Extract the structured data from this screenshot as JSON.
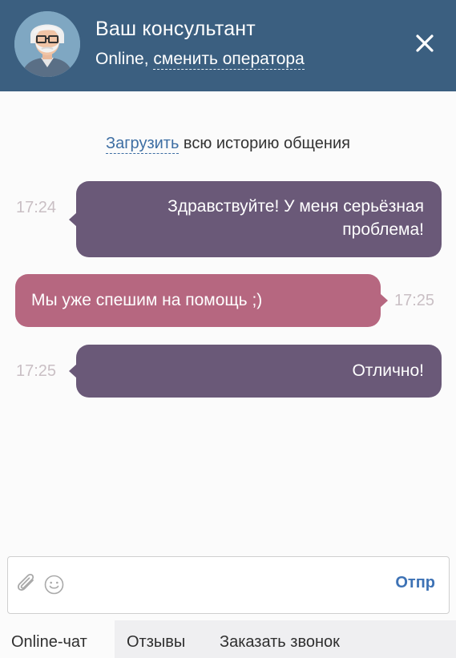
{
  "header": {
    "title": "Ваш консультант",
    "status": "Online,",
    "change_operator": "сменить оператора"
  },
  "history": {
    "link": "Загрузить",
    "text": " всю историю общения"
  },
  "messages": [
    {
      "direction": "incoming",
      "line1": "Здравствуйте! У меня серьёзная",
      "line2": "проблема!",
      "time": "17:24"
    },
    {
      "direction": "outgoing",
      "line1": "Мы уже спешим на помощь ;)",
      "time": "17:25"
    },
    {
      "direction": "incoming",
      "line1": "Отлично!",
      "time": "17:25"
    }
  ],
  "composer": {
    "send_label": "Отпр"
  },
  "tabs": [
    {
      "label": "Online-чат",
      "active": true
    },
    {
      "label": "Отзывы",
      "active": false
    },
    {
      "label": "Заказать звонок",
      "active": false
    }
  ],
  "colors": {
    "header": "#3b5f80",
    "incoming_bubble": "#6a5978",
    "outgoing_bubble": "#b66780",
    "link": "#3d6ea3"
  },
  "icons": [
    "operator-avatar",
    "close-icon",
    "paperclip-icon",
    "smile-icon"
  ]
}
